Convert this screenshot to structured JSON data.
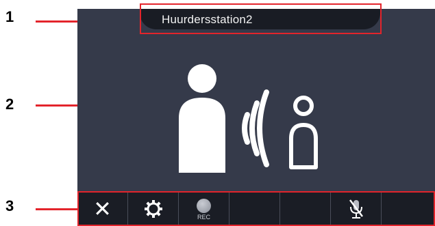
{
  "window": {
    "title": "Huurdersstation2"
  },
  "annotations": {
    "marker_1": "1",
    "marker_2": "2",
    "marker_3": "3"
  },
  "main": {
    "illustration_icon": "person-calling-person-icon"
  },
  "toolbar": {
    "buttons": [
      {
        "icon": "close-icon"
      },
      {
        "icon": "gear-icon"
      },
      {
        "icon": "record-icon",
        "label": "REC"
      },
      {
        "icon": "empty"
      },
      {
        "icon": "empty"
      },
      {
        "icon": "mic-muted-icon"
      },
      {
        "icon": "empty"
      }
    ]
  },
  "colors": {
    "screen_background": "#353a4a",
    "title_bar": "#191c24",
    "toolbar": "#1a1d25",
    "annotation_red": "#e3242b"
  }
}
